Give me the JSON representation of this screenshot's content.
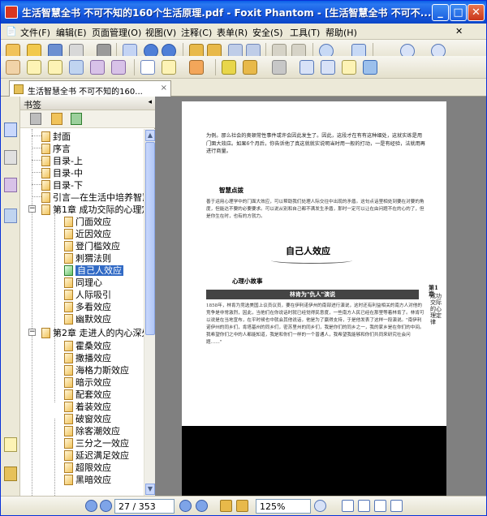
{
  "window": {
    "title": "生活智慧全书  不可不知的160个生活原理.pdf - Foxit Phantom - [生活智慧全书  不可不...",
    "min_symbol": "_",
    "max_symbol": "□",
    "close_symbol": "✕"
  },
  "menu": {
    "items": [
      "文件(F)",
      "编辑(E)",
      "页面管理(O)",
      "视图(V)",
      "注释(C)",
      "表单(R)",
      "安全(S)",
      "工具(T)",
      "帮助(H)"
    ]
  },
  "tab": {
    "label": "生活智慧全书  不可不知的160...",
    "close": "×"
  },
  "bookmarks": {
    "header": "书签",
    "collapse": "◂",
    "items": [
      "封面",
      "序言",
      "目录-上",
      "目录-中",
      "目录-下",
      "引言—在生活中培养智慧",
      "第1章 成功交际的心理定",
      "门面效应",
      "近因效应",
      "登门槛效应",
      "刺猬法则",
      "自己人效应",
      "同理心",
      "人际吸引",
      "多看效应",
      "幽默效应",
      "第2章 走进人的内心深处",
      "霍桑效应",
      "撒播效应",
      "海格力斯效应",
      "暗示效应",
      "配套效应",
      "着装效应",
      "破窗效应",
      "除客潮效应",
      "三分之一效应",
      "延迟满足效应",
      "超限效应",
      "黑暗效应"
    ],
    "expanded_symbol": "−"
  },
  "document": {
    "intro_text": "为例。那么社会的奥顿常性事件或许会因此发生了。因此，这段才在有有这种细处，这就实练是用门面大效应。如果6个月后，你告诉他了真这就就实说明当时用一般的打动，一是有经验，法就用再进行商量。",
    "section1_title": "智慧点拨",
    "section1_text": "善于运用心理学中的门面大效应，可以帮助我们处理人际交往中出现的矛盾。这句点话里相处到要在对要的角度，但能达不要的必要要求。可以说从别和自己都不满发生矛盾，那时一定可以让在由问题不在的心的了，但是你生在时，也有的方就力。",
    "chapter_title": "自己人效应",
    "section2_title": "心理小故事",
    "band_text": "林肯为\"仇人\"演说",
    "story_text": "1858年，林肯为竞选美国上议员议员，要在伊利诺伊州的南部进行演说，这时还有利益相关的南方人对他的竞争是非常激烈，因此，当他们在你说话时就已经觉得民意度，一些南方人民已经在那里等着林肯了。林肯可以说是在当地宣布，在平时候也中就会其他说话，他是为了赢得支持，于是他发表了这样一段演说。\"南伊利诺伊州的同乡们，肯塔基州的同乡们，密苏里州的同乡们，我是你们的同乡之一，我的家乡是在你们的中间。我希望你们之中的人都能知道，我是和你们一样的一个普通人，我希望我能够和你们共同来研究社会问题……\"",
    "side_label": "成功交际的心理定律",
    "side_chapter": "第1章"
  },
  "status": {
    "page_field": "27 / 353",
    "zoom_field": "125%"
  },
  "colors": {
    "title_bar": "#0b46c7",
    "selection": "#316ac5",
    "viewer_bg": "#808080"
  }
}
